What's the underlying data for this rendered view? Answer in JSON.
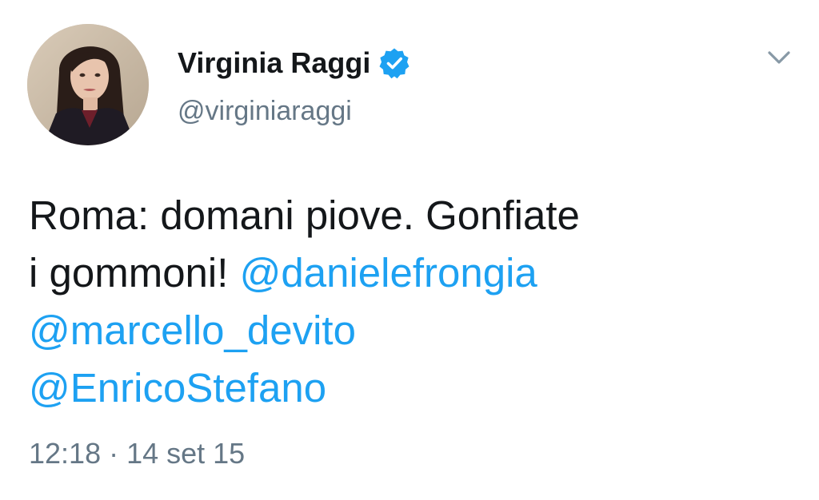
{
  "author": {
    "display_name": "Virginia Raggi",
    "handle": "@virginiaraggi",
    "verified": true,
    "avatar_icon": "profile-photo"
  },
  "menu": {
    "icon": "chevron-down-icon"
  },
  "tweet": {
    "line1": "Roma: domani piove. Gonfiate",
    "line2_prefix": "i gommoni! ",
    "mentions": [
      "@danielefrongia",
      "@marcello_devito",
      "@EnricoStefano"
    ]
  },
  "meta": {
    "time": "12:18",
    "separator": "·",
    "date": "14 set 15"
  },
  "colors": {
    "link": "#1da1f2",
    "text": "#14171a",
    "secondary": "#657786",
    "verified_badge": "#1da1f2"
  }
}
